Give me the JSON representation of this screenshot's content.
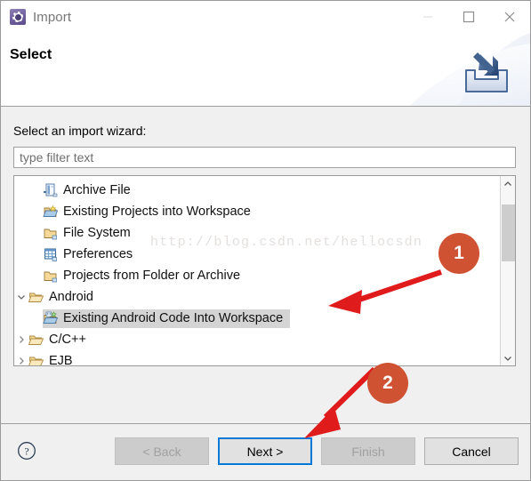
{
  "window": {
    "title": "Import",
    "icon": "eclipse-wizard-icon",
    "controls": [
      {
        "name": "minimize-button",
        "glyph": "minimize-icon"
      },
      {
        "name": "maximize-button",
        "glyph": "maximize-icon"
      },
      {
        "name": "close-button",
        "glyph": "close-icon"
      }
    ]
  },
  "banner": {
    "title": "Select",
    "icon": "import-tray-arrow-icon"
  },
  "body": {
    "prompt": "Select an import wizard:",
    "filter": {
      "value": "",
      "placeholder": "type filter text"
    },
    "tree": [
      {
        "label": "Archive File",
        "icon": "archive-file-icon",
        "indent": 1,
        "expander": "none",
        "selected": false
      },
      {
        "label": "Existing Projects into Workspace",
        "icon": "import-project-icon",
        "indent": 1,
        "expander": "none",
        "selected": false
      },
      {
        "label": "File System",
        "icon": "folder-icon",
        "indent": 1,
        "expander": "none",
        "selected": false
      },
      {
        "label": "Preferences",
        "icon": "preferences-icon",
        "indent": 1,
        "expander": "none",
        "selected": false
      },
      {
        "label": "Projects from Folder or Archive",
        "icon": "folder-icon",
        "indent": 1,
        "expander": "none",
        "selected": false
      },
      {
        "label": "Android",
        "icon": "open-folder-icon",
        "indent": 0,
        "expander": "expanded",
        "selected": false
      },
      {
        "label": "Existing Android Code Into Workspace",
        "icon": "android-import-icon",
        "indent": 1,
        "expander": "none",
        "selected": true
      },
      {
        "label": "C/C++",
        "icon": "open-folder-icon",
        "indent": 0,
        "expander": "collapsed",
        "selected": false
      },
      {
        "label": "EJB",
        "icon": "open-folder-icon",
        "indent": 0,
        "expander": "collapsed",
        "selected": false
      }
    ],
    "scrollbar": {
      "up_arrow": "chevron-up-icon",
      "down_arrow": "chevron-down-icon"
    }
  },
  "watermark": "http://blog.csdn.net/hellocsdn",
  "footer": {
    "help": "help-icon",
    "buttons": [
      {
        "label": "< Back",
        "name": "back-button",
        "state": "disabled"
      },
      {
        "label": "Next >",
        "name": "next-button",
        "state": "default"
      },
      {
        "label": "Finish",
        "name": "finish-button",
        "state": "disabled"
      },
      {
        "label": "Cancel",
        "name": "cancel-button",
        "state": "enabled"
      }
    ]
  },
  "annotations": {
    "color": "#cf5233",
    "arrow_color": "#e01b1b",
    "badges": [
      {
        "label": "1"
      },
      {
        "label": "2"
      }
    ]
  }
}
